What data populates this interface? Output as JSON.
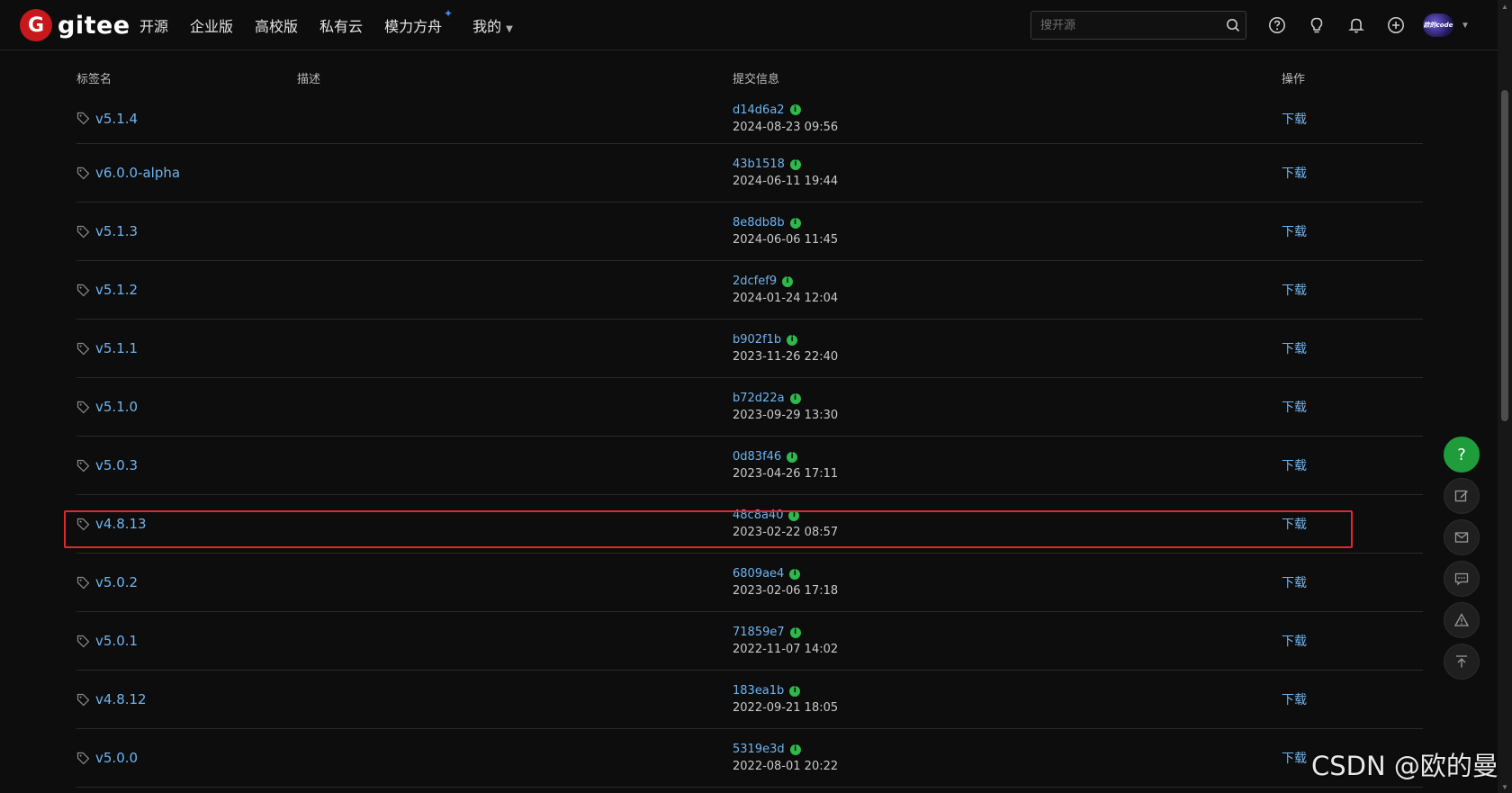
{
  "header": {
    "logo_letter": "G",
    "logo_text": "gitee",
    "nav": [
      "开源",
      "企业版",
      "高校版",
      "私有云",
      "模力方舟",
      "我的"
    ],
    "nav_star": "✦",
    "search_placeholder": "搜开源",
    "avatar_text": "欧的code",
    "accent_color": "#c7191c"
  },
  "table": {
    "columns": [
      "标签名",
      "描述",
      "提交信息",
      "操作"
    ],
    "action_label": "下载",
    "verify_mark": "i",
    "rows": [
      {
        "tag": "v5.1.4",
        "hash": "d14d6a2",
        "date": "2024-08-23 09:56"
      },
      {
        "tag": "v6.0.0-alpha",
        "hash": "43b1518",
        "date": "2024-06-11 19:44"
      },
      {
        "tag": "v5.1.3",
        "hash": "8e8db8b",
        "date": "2024-06-06 11:45"
      },
      {
        "tag": "v5.1.2",
        "hash": "2dcfef9",
        "date": "2024-01-24 12:04"
      },
      {
        "tag": "v5.1.1",
        "hash": "b902f1b",
        "date": "2023-11-26 22:40"
      },
      {
        "tag": "v5.1.0",
        "hash": "b72d22a",
        "date": "2023-09-29 13:30"
      },
      {
        "tag": "v5.0.3",
        "hash": "0d83f46",
        "date": "2023-04-26 17:11"
      },
      {
        "tag": "v4.8.13",
        "hash": "48c8a40",
        "date": "2023-02-22 08:57"
      },
      {
        "tag": "v5.0.2",
        "hash": "6809ae4",
        "date": "2023-02-06 17:18"
      },
      {
        "tag": "v5.0.1",
        "hash": "71859e7",
        "date": "2022-11-07 14:02"
      },
      {
        "tag": "v4.8.12",
        "hash": "183ea1b",
        "date": "2022-09-21 18:05"
      },
      {
        "tag": "v5.0.0",
        "hash": "5319e3d",
        "date": "2022-08-01 20:22"
      }
    ]
  },
  "float_toolbar": {
    "help_label": "?",
    "icons": [
      "help-icon",
      "edit-icon",
      "mail-icon",
      "comment-icon",
      "warning-icon",
      "back-to-top-icon"
    ]
  },
  "watermark": "CSDN @欧的曼",
  "colors": {
    "background": "#0d0d0d",
    "link": "#6fb3ef",
    "verified": "#2fb84c",
    "highlight": "#e3262b",
    "help_button": "#1f9d3a"
  }
}
